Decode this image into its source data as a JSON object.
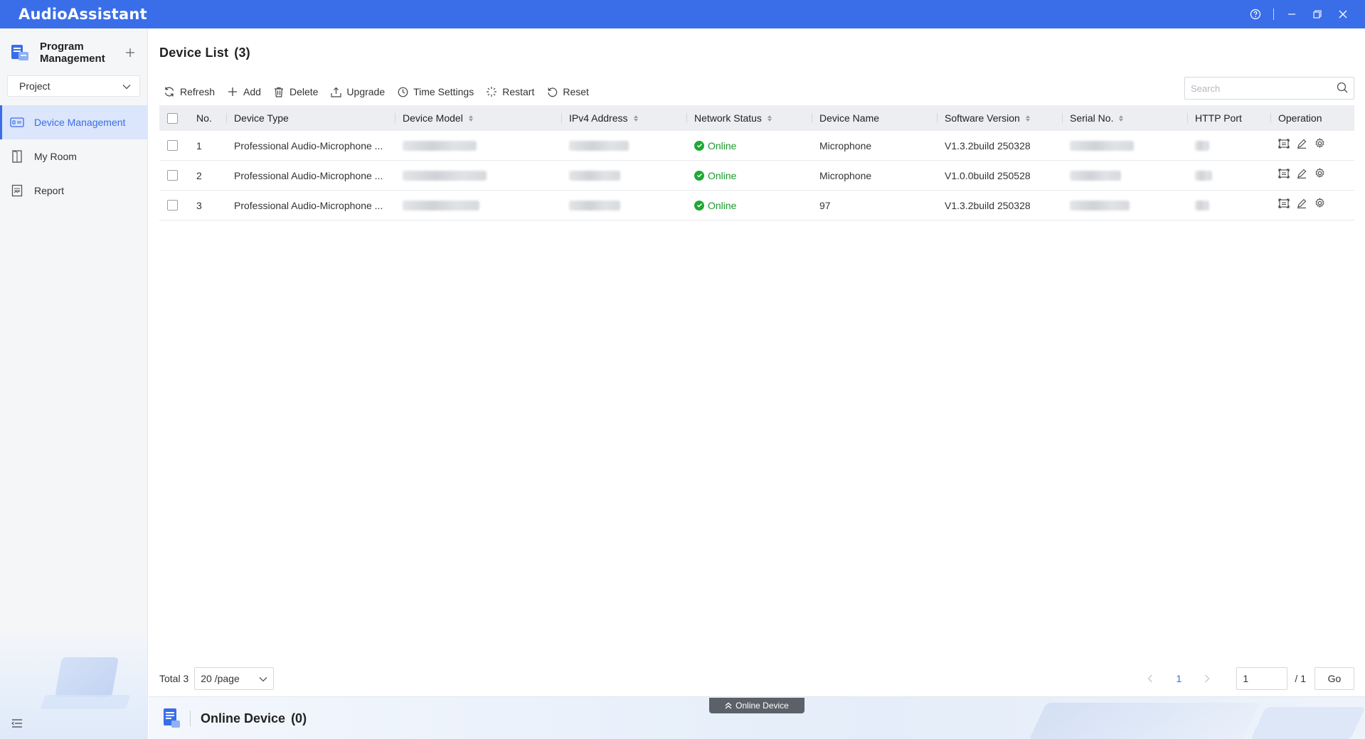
{
  "app": {
    "title": "AudioAssistant"
  },
  "sidebar": {
    "program_title": "Program Management",
    "project_select": "Project",
    "items": [
      {
        "label": "Device Management",
        "icon": "device-icon",
        "active": true
      },
      {
        "label": "My Room",
        "icon": "room-icon",
        "active": false
      },
      {
        "label": "Report",
        "icon": "report-icon",
        "active": false
      }
    ]
  },
  "main": {
    "title": "Device List",
    "count": "(3)",
    "toolbar": {
      "refresh": "Refresh",
      "add": "Add",
      "delete": "Delete",
      "upgrade": "Upgrade",
      "time_settings": "Time Settings",
      "restart": "Restart",
      "reset": "Reset"
    },
    "search_placeholder": "Search",
    "columns": {
      "no": "No.",
      "device_type": "Device Type",
      "device_model": "Device Model",
      "ipv4": "IPv4 Address",
      "network_status": "Network Status",
      "device_name": "Device Name",
      "software_version": "Software Version",
      "serial_no": "Serial No.",
      "http_port": "HTTP Port",
      "operation": "Operation"
    },
    "rows": [
      {
        "no": "1",
        "device_type": "Professional Audio-Microphone ...",
        "status": "Online",
        "name": "Microphone",
        "version": "V1.3.2build 250328"
      },
      {
        "no": "2",
        "device_type": "Professional Audio-Microphone ...",
        "status": "Online",
        "name": "Microphone",
        "version": "V1.0.0build 250528"
      },
      {
        "no": "3",
        "device_type": "Professional Audio-Microphone ...",
        "status": "Online",
        "name": "97",
        "version": "V1.3.2build 250328"
      }
    ],
    "pagination": {
      "total": "Total 3",
      "page_size": "20 /page",
      "current": "1",
      "input": "1",
      "of": "/ 1",
      "go": "Go"
    }
  },
  "bottom": {
    "tab_label": "Online Device",
    "title": "Online Device",
    "count": "(0)"
  },
  "colors": {
    "accent": "#3a6ee8",
    "online": "#1fa835"
  }
}
